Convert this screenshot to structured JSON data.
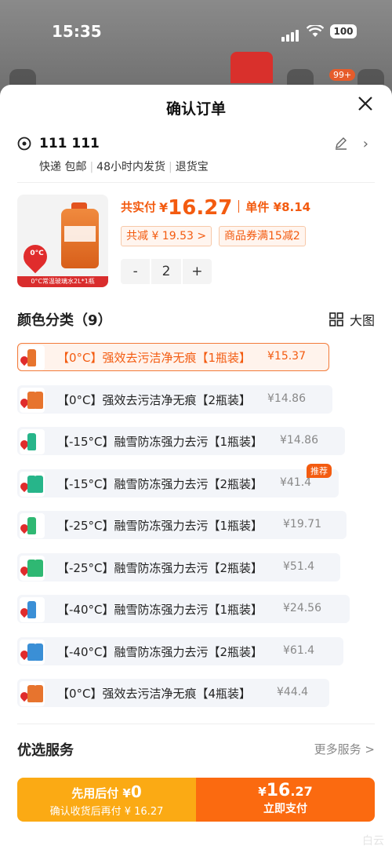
{
  "status": {
    "time": "15:35",
    "battery": "100"
  },
  "background": {
    "badge": "99+"
  },
  "sheet": {
    "title": "确认订单"
  },
  "address": {
    "name": "111 111",
    "shipping": [
      "快递 包邮",
      "48小时内发货",
      "退货宝"
    ]
  },
  "product": {
    "thumb_temp": "0°C",
    "thumb_caption": "0°C常温玻璃水2L*1瓶",
    "pay_label": "共实付",
    "yen": "¥",
    "pay_amount": "16.27",
    "unit_label": "单件 ¥8.14",
    "discount_tag": "共减 ¥ 19.53 >",
    "coupon_tag": "商品券满15减2",
    "qty_minus": "-",
    "qty": "2",
    "qty_plus": "+"
  },
  "variants": {
    "title": "颜色分类（9）",
    "big_view": "大图",
    "recommend": "推荐",
    "items": [
      {
        "label": "【0°C】强效去污洁净无痕【1瓶装】",
        "price": "¥15.37",
        "color": "#e7742e",
        "two": false
      },
      {
        "label": "【0°C】强效去污洁净无痕【2瓶装】",
        "price": "¥14.86",
        "color": "#e7742e",
        "two": true
      },
      {
        "label": "【-15°C】融雪防冻强力去污【1瓶装】",
        "price": "¥14.86",
        "color": "#27b58a",
        "two": false
      },
      {
        "label": "【-15°C】融雪防冻强力去污【2瓶装】",
        "price": "¥41.4",
        "color": "#27b58a",
        "two": true
      },
      {
        "label": "【-25°C】融雪防冻强力去污【1瓶装】",
        "price": "¥19.71",
        "color": "#2fb873",
        "two": false
      },
      {
        "label": "【-25°C】融雪防冻强力去污【2瓶装】",
        "price": "¥51.4",
        "color": "#2fb873",
        "two": true
      },
      {
        "label": "【-40°C】融雪防冻强力去污【1瓶装】",
        "price": "¥24.56",
        "color": "#3a8fd6",
        "two": false
      },
      {
        "label": "【-40°C】融雪防冻强力去污【2瓶装】",
        "price": "¥61.4",
        "color": "#3a8fd6",
        "two": true
      },
      {
        "label": "【0°C】强效去污洁净无痕【4瓶装】",
        "price": "¥44.4",
        "color": "#e7742e",
        "two": true
      }
    ]
  },
  "services": {
    "title": "优选服务",
    "more": "更多服务 >"
  },
  "paybar": {
    "later_label": "先用后付 ¥",
    "later_amount": "0",
    "later_sub": "确认收货后再付 ¥ 16.27",
    "now_yen": "¥",
    "now_int": "16",
    "now_dec": ".27",
    "now_label": "立即支付"
  },
  "watermark": "白云"
}
